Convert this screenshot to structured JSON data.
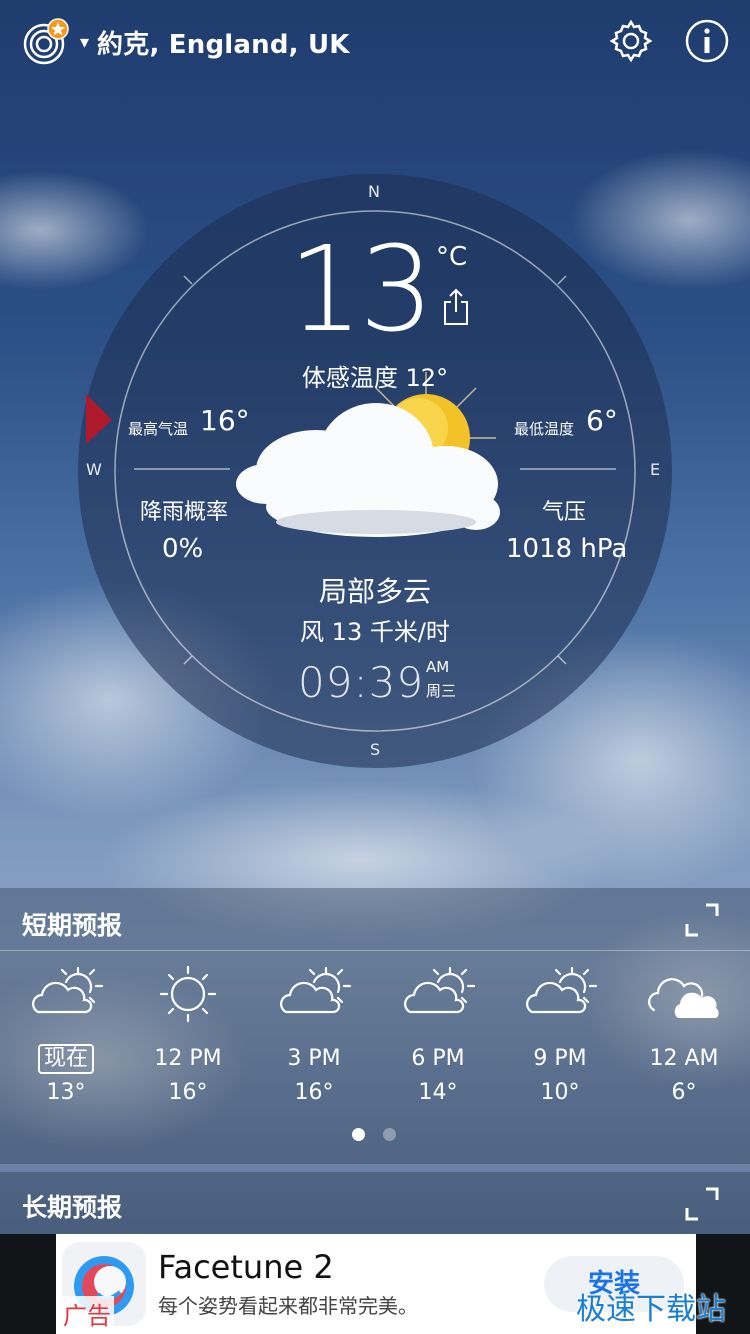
{
  "header": {
    "location": "約克, England, UK",
    "caret": "▾"
  },
  "dial": {
    "directions": {
      "n": "N",
      "e": "E",
      "s": "S",
      "w": "W"
    },
    "temperature": "13",
    "unit": "°C",
    "feels_like": "体感温度 12°",
    "high_label": "最高气温",
    "high_value": "16°",
    "low_label": "最低温度",
    "low_value": "6°",
    "rain_label": "降雨概率",
    "rain_value": "0%",
    "pressure_label": "气压",
    "pressure_value": "1018 hPa",
    "condition": "局部多云",
    "wind": "风 13 千米/时",
    "time": "09:39",
    "ampm": "AM",
    "weekday": "周三",
    "condition_icon": "partly-cloudy-icon"
  },
  "short_forecast": {
    "title": "短期预报",
    "hours": [
      {
        "label": "现在",
        "temp": "13°",
        "icon": "partly-sunny-icon"
      },
      {
        "label": "12 PM",
        "temp": "16°",
        "icon": "sun-icon"
      },
      {
        "label": "3 PM",
        "temp": "16°",
        "icon": "partly-sunny-icon"
      },
      {
        "label": "6 PM",
        "temp": "14°",
        "icon": "partly-sunny-icon"
      },
      {
        "label": "9 PM",
        "temp": "10°",
        "icon": "partly-sunny-icon"
      },
      {
        "label": "12 AM",
        "temp": "6°",
        "icon": "cloud-icon"
      }
    ],
    "page_count": 2,
    "active_page": 1
  },
  "long_forecast": {
    "title": "长期预报"
  },
  "ad": {
    "title": "Facetune 2",
    "subtitle": "每个姿势看起来都非常完美。",
    "install": "安装",
    "tag": "广告"
  },
  "watermark": "极速下载站",
  "colors": {
    "accent_red": "#b0182c",
    "install_blue": "#1a73e8",
    "logo_star": "#f39a1e"
  }
}
